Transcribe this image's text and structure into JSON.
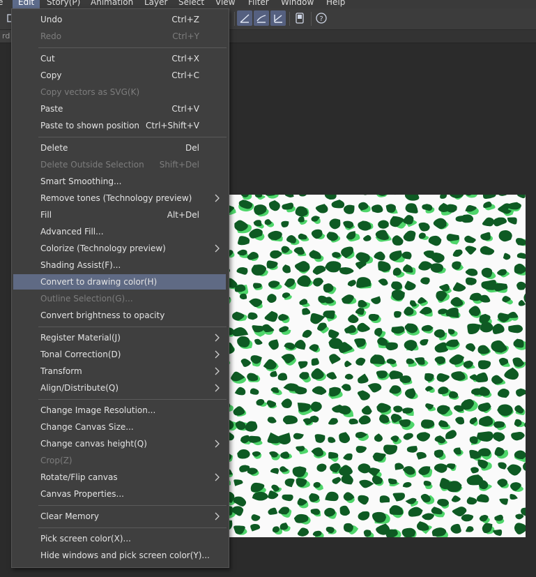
{
  "menubar": {
    "items": [
      {
        "label": "e"
      },
      {
        "label": "Edit"
      },
      {
        "label": "Story(P)"
      },
      {
        "label": "Animation"
      },
      {
        "label": "Layer"
      },
      {
        "label": "Select"
      },
      {
        "label": "View"
      },
      {
        "label": "Filter"
      },
      {
        "label": "Window"
      },
      {
        "label": "Help"
      }
    ]
  },
  "tab": {
    "label": "rd"
  },
  "colors": {
    "menu_bg": "#3f3f3f",
    "highlight": "#5f6a84",
    "canvas": "#fafafa",
    "spot_dark": "#0e5a23",
    "spot_light": "#4fd66b"
  },
  "menu": {
    "items": [
      {
        "label": "Undo",
        "shortcut": "Ctrl+Z"
      },
      {
        "label": "Redo",
        "shortcut": "Ctrl+Y"
      },
      {
        "label": "Cut",
        "shortcut": "Ctrl+X"
      },
      {
        "label": "Copy",
        "shortcut": "Ctrl+C"
      },
      {
        "label": "Copy vectors as SVG(K)",
        "shortcut": ""
      },
      {
        "label": "Paste",
        "shortcut": "Ctrl+V"
      },
      {
        "label": "Paste to shown position",
        "shortcut": "Ctrl+Shift+V"
      },
      {
        "label": "Delete",
        "shortcut": "Del"
      },
      {
        "label": "Delete Outside Selection",
        "shortcut": "Shift+Del"
      },
      {
        "label": "Smart Smoothing...",
        "shortcut": ""
      },
      {
        "label": "Remove tones (Technology preview)",
        "shortcut": ""
      },
      {
        "label": "Fill",
        "shortcut": "Alt+Del"
      },
      {
        "label": "Advanced Fill...",
        "shortcut": ""
      },
      {
        "label": "Colorize (Technology preview)",
        "shortcut": ""
      },
      {
        "label": "Shading Assist(F)...",
        "shortcut": ""
      },
      {
        "label": "Convert to drawing color(H)",
        "shortcut": ""
      },
      {
        "label": "Outline Selection(G)...",
        "shortcut": ""
      },
      {
        "label": "Convert brightness to opacity",
        "shortcut": ""
      },
      {
        "label": "Register Material(J)",
        "shortcut": ""
      },
      {
        "label": "Tonal Correction(D)",
        "shortcut": ""
      },
      {
        "label": "Transform",
        "shortcut": ""
      },
      {
        "label": "Align/Distribute(Q)",
        "shortcut": ""
      },
      {
        "label": "Change Image Resolution...",
        "shortcut": ""
      },
      {
        "label": "Change Canvas Size...",
        "shortcut": ""
      },
      {
        "label": "Change canvas height(Q)",
        "shortcut": ""
      },
      {
        "label": "Crop(Z)",
        "shortcut": ""
      },
      {
        "label": "Rotate/Flip canvas",
        "shortcut": ""
      },
      {
        "label": "Canvas Properties...",
        "shortcut": ""
      },
      {
        "label": "Clear Memory",
        "shortcut": ""
      },
      {
        "label": "Pick screen color(X)...",
        "shortcut": ""
      },
      {
        "label": "Hide windows and pick screen color(Y)...",
        "shortcut": ""
      }
    ]
  }
}
